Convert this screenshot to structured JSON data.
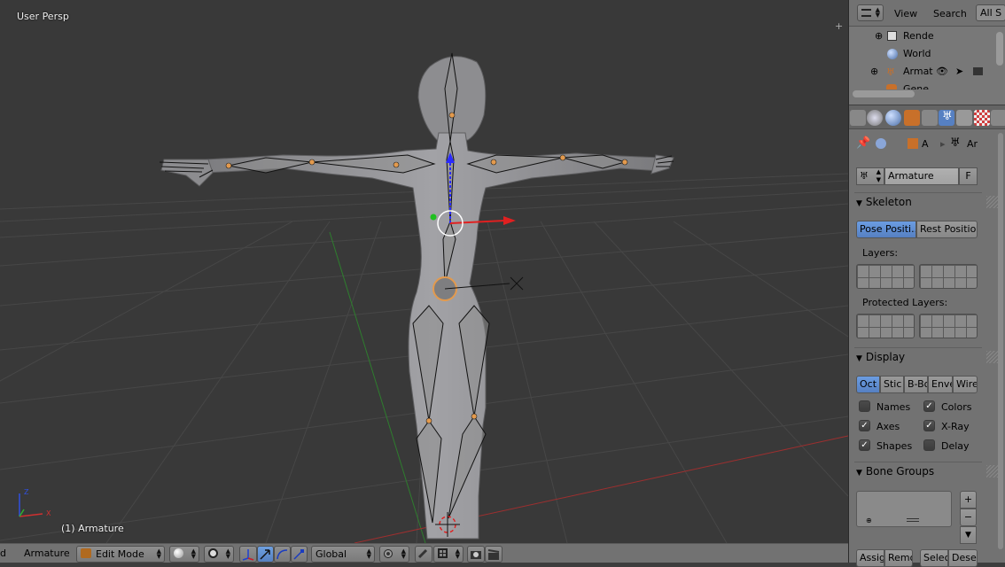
{
  "viewport": {
    "view_label": "User Persp",
    "object_label": "(1) Armature",
    "axis_labels": {
      "x": "X",
      "y": "Y",
      "z": "Z"
    }
  },
  "header3d": {
    "editor_partial": "d",
    "object_name": "Armature",
    "mode": "Edit Mode",
    "orientation": "Global"
  },
  "outliner": {
    "menu_view": "View",
    "menu_search": "Search",
    "filter": "All S",
    "rows": [
      {
        "label": "Rende",
        "icon": "camera-render-icon"
      },
      {
        "label": "World",
        "icon": "world-icon"
      },
      {
        "label": "Armat",
        "icon": "armature-icon"
      },
      {
        "label": "Gene",
        "icon": "mesh-icon"
      }
    ]
  },
  "properties": {
    "path_object": "A",
    "path_data": "Ar",
    "datablock_name": "Armature",
    "fake_user": "F",
    "skeleton": {
      "title": "Skeleton",
      "pose_position": "Pose Positi...",
      "rest_position": "Rest Position",
      "layers_label": "Layers:",
      "protected_layers_label": "Protected Layers:"
    },
    "display": {
      "title": "Display",
      "modes": [
        "Oct",
        "Stic",
        "B-Bo",
        "Enve",
        "Wire"
      ],
      "active_mode": "Oct",
      "options": [
        {
          "label": "Names",
          "checked": false
        },
        {
          "label": "Colors",
          "checked": true
        },
        {
          "label": "Axes",
          "checked": true
        },
        {
          "label": "X-Ray",
          "checked": true
        },
        {
          "label": "Shapes",
          "checked": true
        },
        {
          "label": "Delay",
          "checked": false
        }
      ]
    },
    "bone_groups": {
      "title": "Bone Groups",
      "buttons": [
        "Assig",
        "Remo",
        "Selec",
        "Desel"
      ]
    }
  },
  "colors": {
    "viewport_bg": "#393939",
    "grid": "#4a4a4a",
    "x_axis": "#b03030",
    "y_axis": "#2e8b2e",
    "active_blue": "#5680c2",
    "panel_bg": "#727272"
  }
}
